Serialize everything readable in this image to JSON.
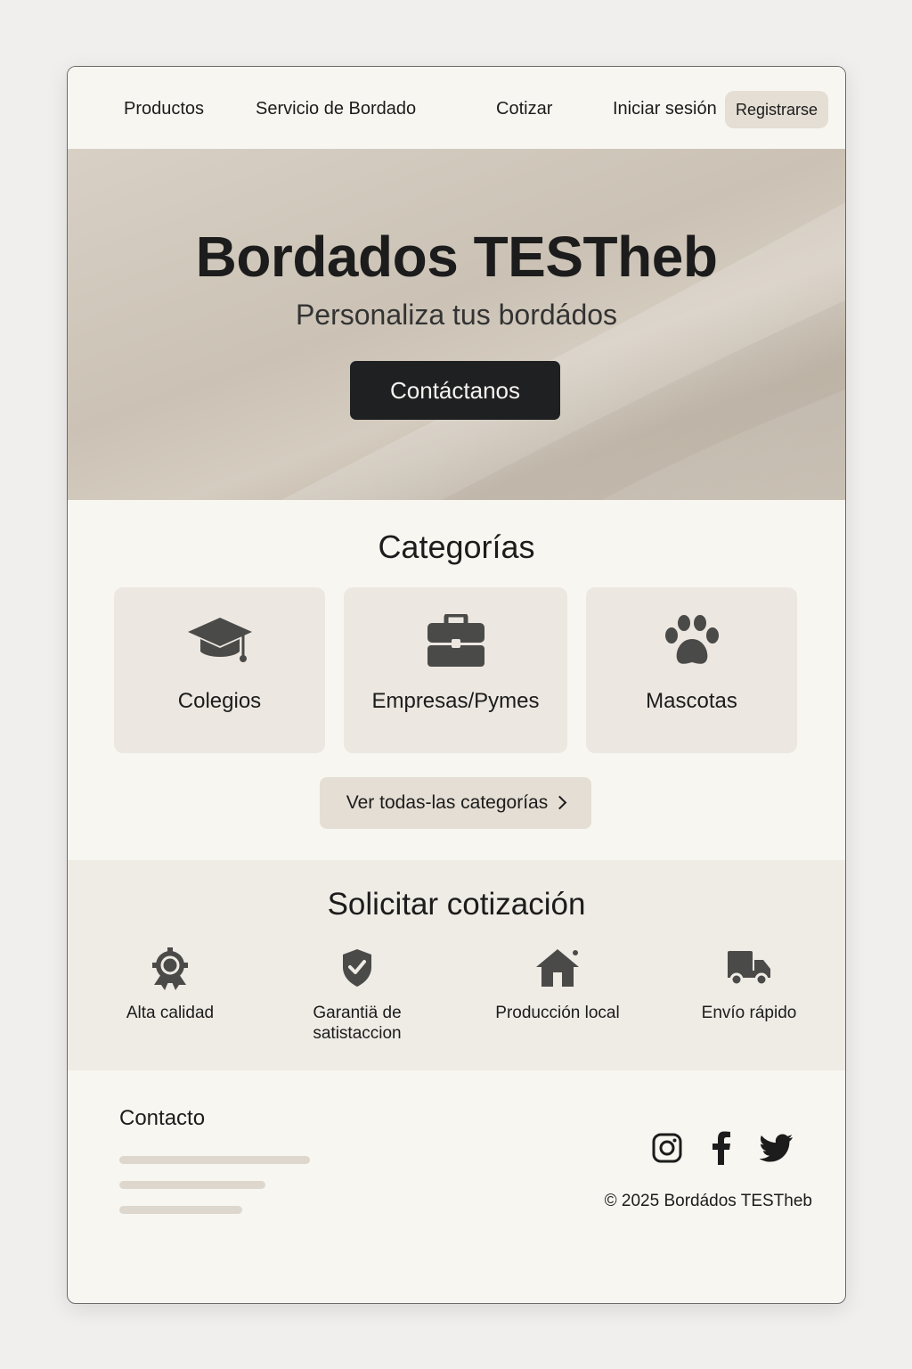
{
  "nav": {
    "items": [
      {
        "label": "Productos"
      },
      {
        "label": "Servicio de Bordado"
      },
      {
        "label": "Cotizar"
      },
      {
        "label": "Iniciar sesión"
      }
    ],
    "register_label": "Registrarse"
  },
  "hero": {
    "title": "Bordados TESTheb",
    "subtitle": "Personaliza tus bordádos",
    "cta_label": "Contáctanos"
  },
  "categories": {
    "title": "Categorías",
    "items": [
      {
        "label": "Colegios",
        "icon": "graduation-cap-icon"
      },
      {
        "label": "Empresas/Pymes",
        "icon": "briefcase-icon"
      },
      {
        "label": "Mascotas",
        "icon": "paw-icon"
      }
    ],
    "view_all_label": "Ver todas-las categorías"
  },
  "quote": {
    "title": "Solicitar cotización",
    "features": [
      {
        "label": "Alta calidad",
        "icon": "award-badge-icon"
      },
      {
        "label": "Garantiä de satistaccion",
        "icon": "shield-check-icon"
      },
      {
        "label": "Producción local",
        "icon": "house-icon"
      },
      {
        "label": "Envío rápido",
        "icon": "truck-icon"
      }
    ]
  },
  "footer": {
    "contact_title": "Contacto",
    "social": [
      {
        "icon": "instagram-icon"
      },
      {
        "icon": "facebook-icon"
      },
      {
        "icon": "twitter-icon"
      }
    ],
    "copyright": "© 2025 Bordádos TESTheb"
  },
  "colors": {
    "background": "#f8f6f1",
    "accent_dark": "#1f2022",
    "button_beige": "#e4ded4",
    "card": "#ece7e0",
    "icon": "#4a4a48"
  }
}
